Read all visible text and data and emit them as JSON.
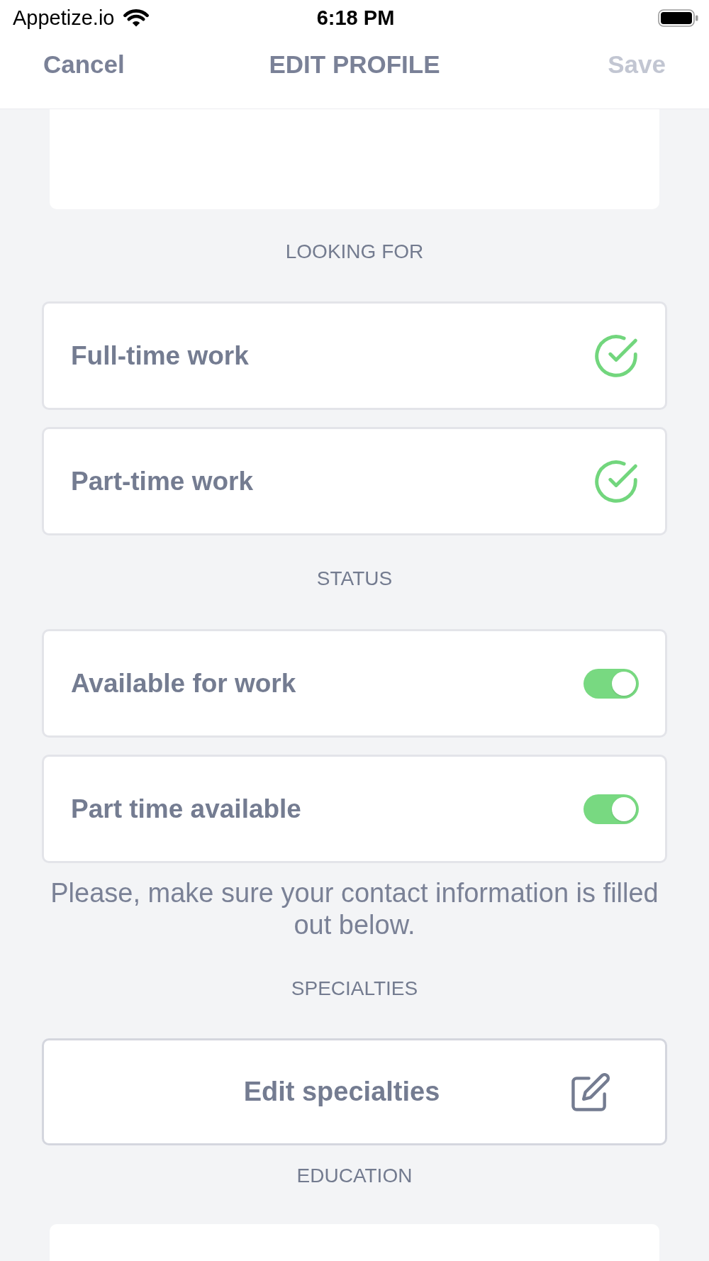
{
  "status_bar": {
    "carrier": "Appetize.io",
    "time": "6:18 PM"
  },
  "nav_bar": {
    "cancel": "Cancel",
    "title": "EDIT PROFILE",
    "save": {
      "label": "Save",
      "disabled": true
    }
  },
  "looking_for": {
    "heading": "LOOKING FOR",
    "options": [
      {
        "label": "Full-time work",
        "checked": true
      },
      {
        "label": "Part-time work",
        "checked": true
      }
    ]
  },
  "status": {
    "heading": "STATUS",
    "switches": [
      {
        "label": "Available for work",
        "on": true
      },
      {
        "label": "Part time available",
        "on": true
      }
    ],
    "note": "Please, make sure your contact information is filled out below."
  },
  "specialties": {
    "heading": "SPECIALTIES",
    "button": "Edit specialties"
  },
  "education": {
    "heading": "EDUCATION"
  }
}
